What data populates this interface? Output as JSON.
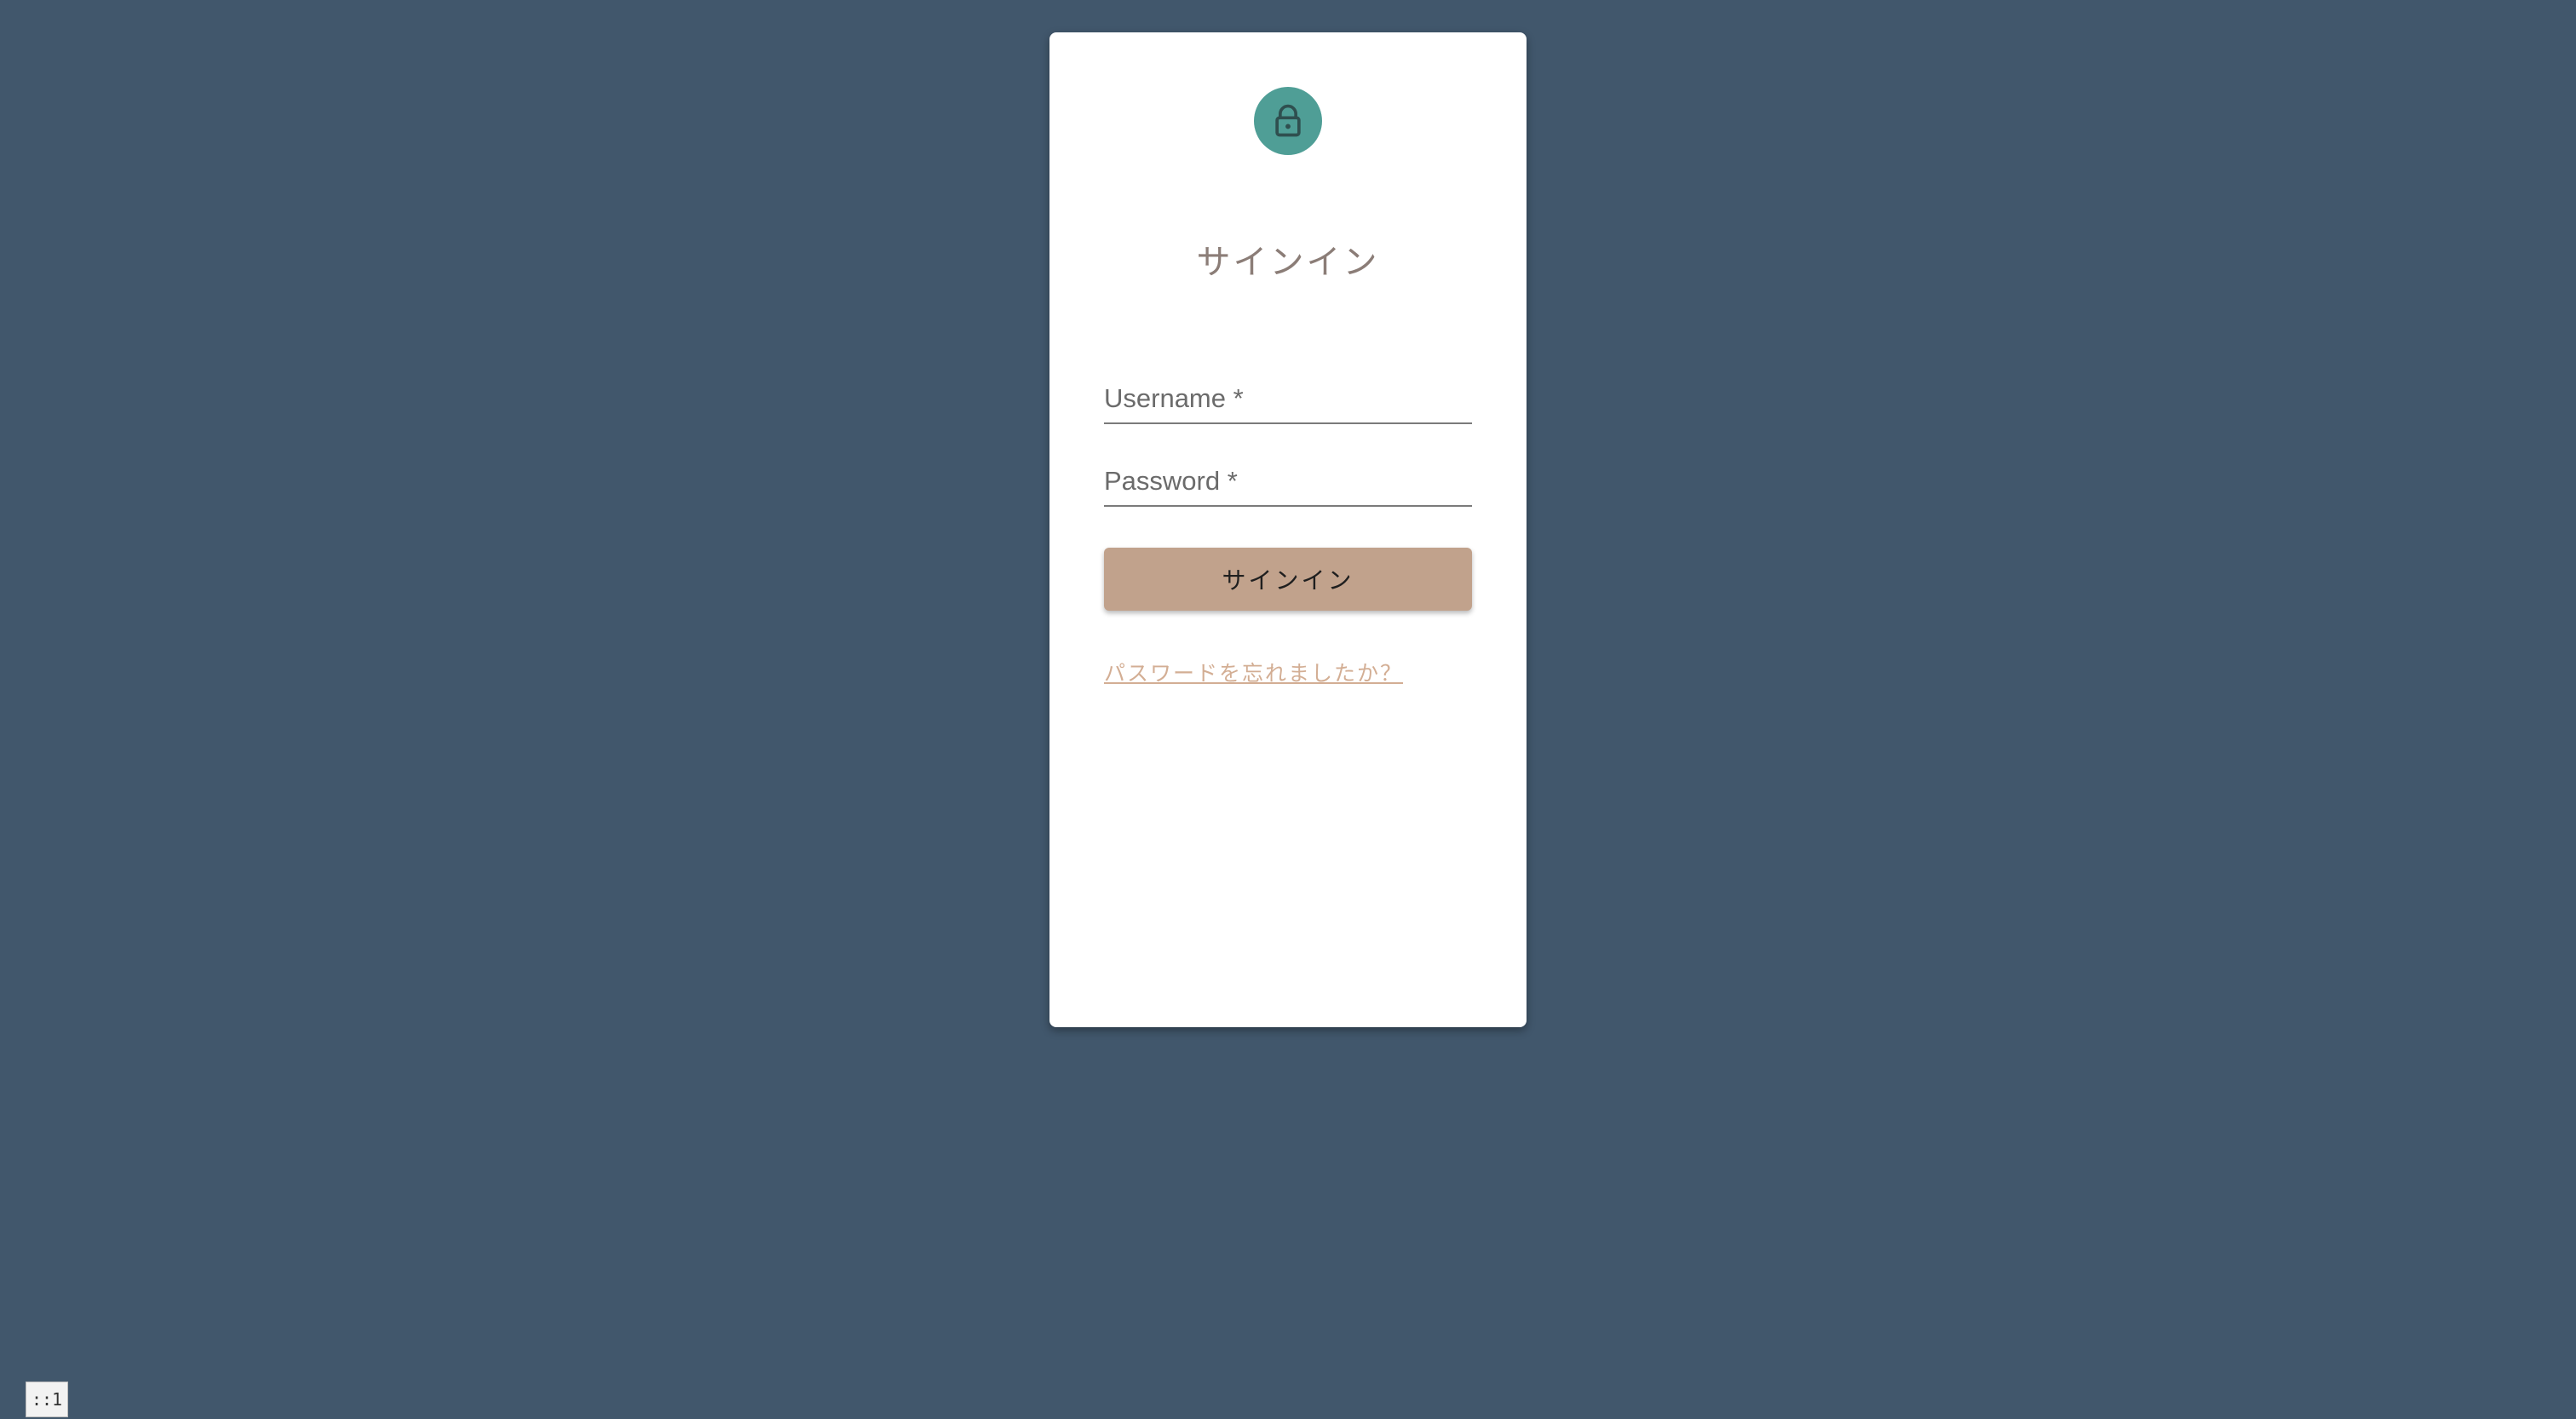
{
  "login_card": {
    "title": "サインイン",
    "icon": "lock-icon",
    "username": {
      "label": "Username *",
      "value": ""
    },
    "password": {
      "label": "Password *",
      "value": ""
    },
    "submit_label": "サインイン",
    "forgot_password_label": "パスワードを忘れましたか？"
  },
  "corner_badge": "::1",
  "colors": {
    "background": "#41576c",
    "card": "#ffffff",
    "avatar": "#4f9e96",
    "button": "#c1a28c",
    "link": "#d3ae94",
    "title": "#8b7d77"
  }
}
